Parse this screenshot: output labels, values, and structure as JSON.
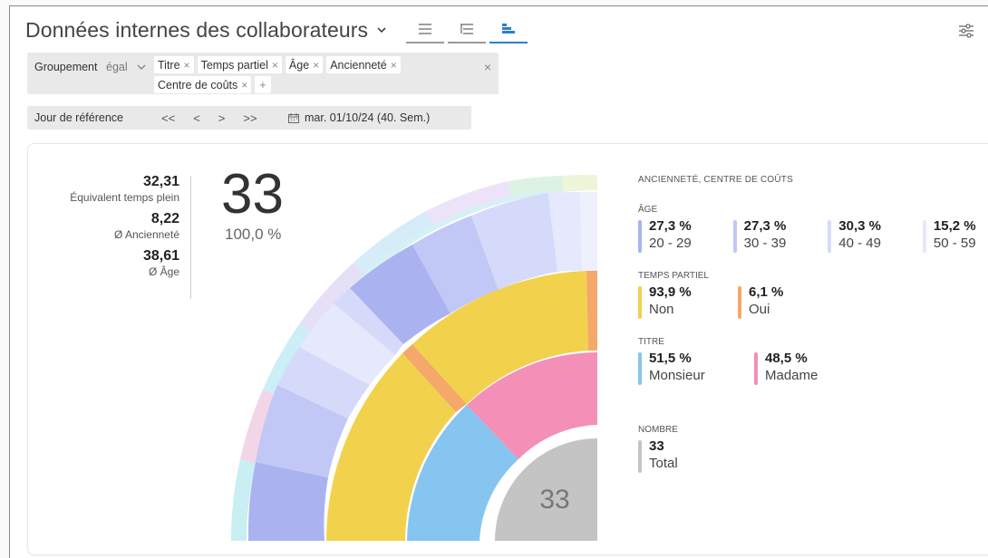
{
  "header": {
    "title": "Données internes des collaborateurs"
  },
  "filter": {
    "label": "Groupement",
    "operator": "égal",
    "chips": [
      "Titre",
      "Temps partiel",
      "Âge",
      "Ancienneté",
      "Centre de coûts"
    ],
    "plus": "+",
    "clear": "×"
  },
  "date": {
    "label": "Jour de référence",
    "nav": [
      "<<",
      "<",
      ">",
      ">>"
    ],
    "value": "mar. 01/10/24 (40. Sem.)"
  },
  "stats": [
    {
      "value": "32,31",
      "label": "Équivalent temps plein"
    },
    {
      "value": "8,22",
      "label": "Ø Ancienneté"
    },
    {
      "value": "38,61",
      "label": "Ø Âge"
    }
  ],
  "total": {
    "value": "33",
    "percent": "100,0 %"
  },
  "center_label": "33",
  "legend": {
    "title": "ANCIENNETÉ, CENTRE DE COÛTS",
    "groups": [
      {
        "title": "ÂGE",
        "items": [
          {
            "value": "27,3 %",
            "label": "20 - 29",
            "color": "#aab3f0"
          },
          {
            "value": "27,3 %",
            "label": "30 - 39",
            "color": "#c2c8f5"
          },
          {
            "value": "30,3 %",
            "label": "40 - 49",
            "color": "#d6dafa"
          },
          {
            "value": "15,2 %",
            "label": "50 - 59",
            "color": "#e6e8fc"
          }
        ]
      },
      {
        "title": "TEMPS PARTIEL",
        "items": [
          {
            "value": "93,9 %",
            "label": "Non",
            "color": "#f2d14c"
          },
          {
            "value": "6,1 %",
            "label": "Oui",
            "color": "#f4a86a"
          }
        ]
      },
      {
        "title": "TITRE",
        "items": [
          {
            "value": "51,5 %",
            "label": "Monsieur",
            "color": "#86c5ef"
          },
          {
            "value": "48,5 %",
            "label": "Madame",
            "color": "#f48fb8"
          }
        ]
      },
      {
        "title": "NOMBRE",
        "items": [
          {
            "value": "33",
            "label": "Total",
            "color": "#c4c4c4"
          }
        ]
      }
    ]
  },
  "colors": {
    "accent": "#2a7fcf",
    "center": "#c4c4c4",
    "monsieur": "#86c5ef",
    "madame": "#f48fb8",
    "non": "#f2d14c",
    "oui": "#f4a86a"
  }
}
